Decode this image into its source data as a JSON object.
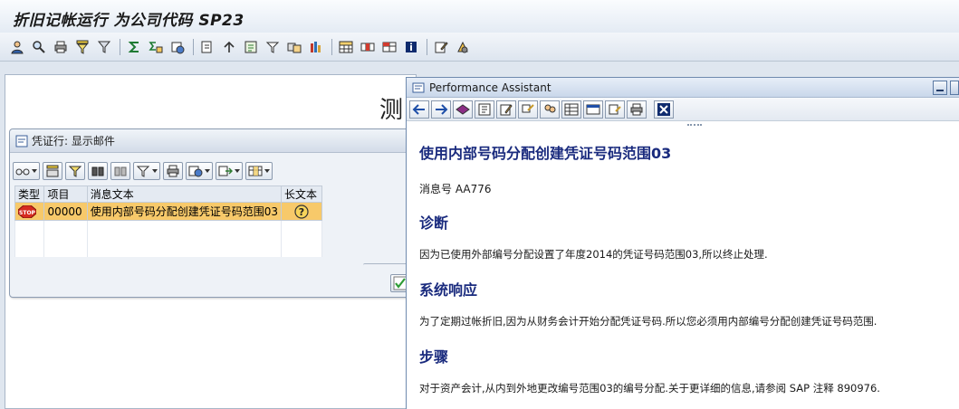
{
  "window": {
    "title": "折旧记帐运行 为公司代码 SP23"
  },
  "toolbar": {
    "icons": [
      "person-icon",
      "find-icon",
      "print-icon",
      "filter-icon",
      "filter-set-icon",
      "sum-icon",
      "subtotal-icon",
      "graphic-icon",
      "export-icon",
      "sort-asc-icon",
      "sort-desc-icon",
      "details-icon",
      "column-icon",
      "change-layout-icon",
      "select-layout-icon",
      "save-layout-icon",
      "info-icon",
      "edit-icon",
      "settings-icon"
    ]
  },
  "main": {
    "bg_title": "测"
  },
  "voucher_popup": {
    "title": "凭证行: 显示邮件",
    "columns": [
      "类型",
      "项目",
      "消息文本",
      "长文本"
    ],
    "rows": [
      {
        "type_icon": "stop-icon",
        "item": "00000",
        "text": "使用内部号码分配创建凭证号码范围03",
        "longtext_icon": "question-icon"
      }
    ]
  },
  "performance_assistant": {
    "title": "Performance Assistant",
    "heading": "使用内部号码分配创建凭证号码范围03",
    "message_no": "消息号 AA776",
    "sections": [
      {
        "title": "诊断",
        "text": "因为已使用外部编号分配设置了年度2014的凭证号码范围03,所以终止处理."
      },
      {
        "title": "系统响应",
        "text": "为了定期过帐折旧,因为从财务会计开始分配凭证号码.所以您必须用内部编号分配创建凭证号码范围."
      },
      {
        "title": "步骤",
        "text": "对于资产会计,从内到外地更改编号范围03的编号分配.关于更详细的信息,请参阅 SAP 注释 890976."
      }
    ]
  },
  "colors": {
    "heading_blue": "#1a2b7e",
    "selected_row": "#f7c96a",
    "stop_red": "#d62b1f"
  }
}
